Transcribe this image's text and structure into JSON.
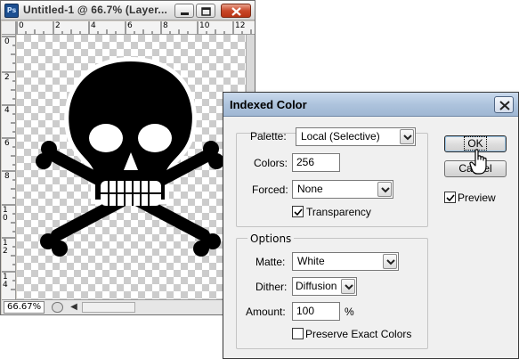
{
  "document_window": {
    "app_icon_text": "Ps",
    "title": "Untitled-1 @ 66.7% (Layer...",
    "ruler_top_labels": [
      "0",
      "2",
      "4",
      "6",
      "8",
      "10",
      "12"
    ],
    "ruler_left_labels": [
      "0",
      "2",
      "4",
      "6",
      "8",
      "10",
      "12",
      "14"
    ],
    "zoom_level": "66.67%"
  },
  "dialog": {
    "title": "Indexed Color",
    "palette": {
      "palette_label": "Palette:",
      "palette_value": "Local (Selective)",
      "colors_label": "Colors:",
      "colors_value": "256",
      "forced_label": "Forced:",
      "forced_value": "None",
      "transparency_label": "Transparency",
      "transparency_checked": true
    },
    "options": {
      "legend": "Options",
      "matte_label": "Matte:",
      "matte_value": "White",
      "dither_label": "Dither:",
      "dither_value": "Diffusion",
      "amount_label": "Amount:",
      "amount_value": "100",
      "amount_unit": "%",
      "preserve_label": "Preserve Exact Colors",
      "preserve_checked": false
    },
    "buttons": {
      "ok_label": "OK",
      "cancel_label": "Cancel"
    },
    "preview_label": "Preview",
    "preview_checked": true
  },
  "colors": {
    "dialog_title_bar": "#aec4dd",
    "close_button_red": "#c9482a",
    "checker_gray": "#cccccc"
  }
}
